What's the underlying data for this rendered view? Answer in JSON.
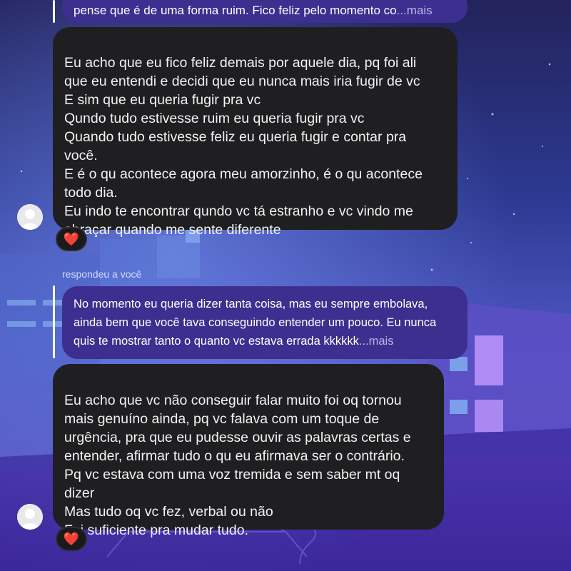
{
  "thread": {
    "messages": [
      {
        "quoted_text": "pense que é de uma forma ruim. Fico feliz pelo momento co",
        "quoted_more": "...mais",
        "text": "Eu acho que eu fico feliz demais por aquele dia, pq foi ali\nque eu entendi e decidi que eu nunca mais iria fugir de vc\nE sim que eu queria fugir pra vc\nQundo tudo estivesse ruim eu queria fugir pra vc\nQuando tudo estivesse feliz eu queria fugir e contar pra\nvocê.\nE é o qu acontece agora meu amorzinho, é o qu acontece\ntodo dia.\nEu indo te encontrar qundo vc tá estranho e vc vindo me\nabraçar quando me sente diferente",
        "reaction": "❤️"
      },
      {
        "reply_label": "respondeu a você",
        "quoted_text": "No momento eu queria dizer tanta coisa, mas eu sempre embolava, ainda bem que você tava conseguindo entender um pouco. Eu nunca quis te mostrar tanto o quanto vc estava errada kkkkkk",
        "quoted_more": "...mais",
        "text": "Eu acho que vc não conseguir falar muito foi oq tornou\nmais genuíno ainda, pq vc falava com um toque de\nurgência, pra que eu pudesse ouvir as palavras certas e\nentender, afirmar tudo o qu eu afirmava ser o contrário.\nPq vc estava com uma voz tremida e sem saber mt oq\ndizer\nMas tudo oq vc fez, verbal ou não\nFoi suficiente pra mudar tudo.",
        "reaction": "❤️"
      }
    ]
  },
  "colors": {
    "bubble_bg": "#1f1f21",
    "reply_bubble_bg": "#3d2f8f",
    "more_link": "#b9b3e8"
  },
  "icons": {
    "avatar": "default-user-avatar-icon",
    "reaction": "heart-reaction-icon"
  }
}
